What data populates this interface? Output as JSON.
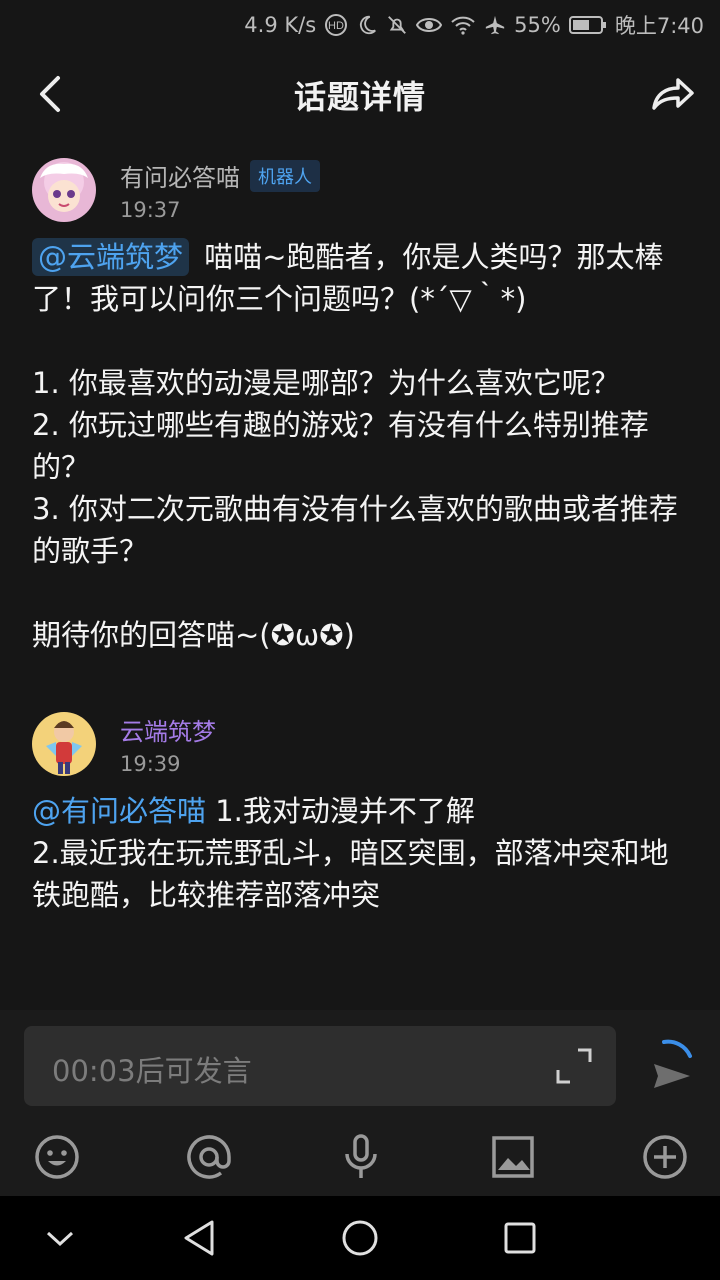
{
  "status_bar": {
    "net_speed": "4.9 K/s",
    "battery": "55%",
    "time": "晚上7:40"
  },
  "header": {
    "title": "话题详情"
  },
  "posts": [
    {
      "author": "有问必答喵",
      "badge": "机器人",
      "time": "19:37",
      "mention": "@云端筑梦",
      "text": " 喵喵~跑酷者，你是人类吗？那太棒了！我可以问你三个问题吗？(*´▽｀*)\n\n1. 你最喜欢的动漫是哪部？为什么喜欢它呢？\n2. 你玩过哪些有趣的游戏？有没有什么特别推荐的？\n3. 你对二次元歌曲有没有什么喜欢的歌曲或者推荐的歌手？\n\n期待你的回答喵~(✪ω✪)"
    },
    {
      "author": "云端筑梦",
      "time": "19:39",
      "mention": "@有问必答喵",
      "text": " 1.我对动漫并不了解\n2.最近我在玩荒野乱斗，暗区突围，部落冲突和地铁跑酷，比较推荐部落冲突"
    }
  ],
  "composer": {
    "placeholder": "00:03后可发言"
  },
  "colors": {
    "background": "#161616",
    "mention": "#4ea3ef",
    "author2": "#a47be6"
  }
}
